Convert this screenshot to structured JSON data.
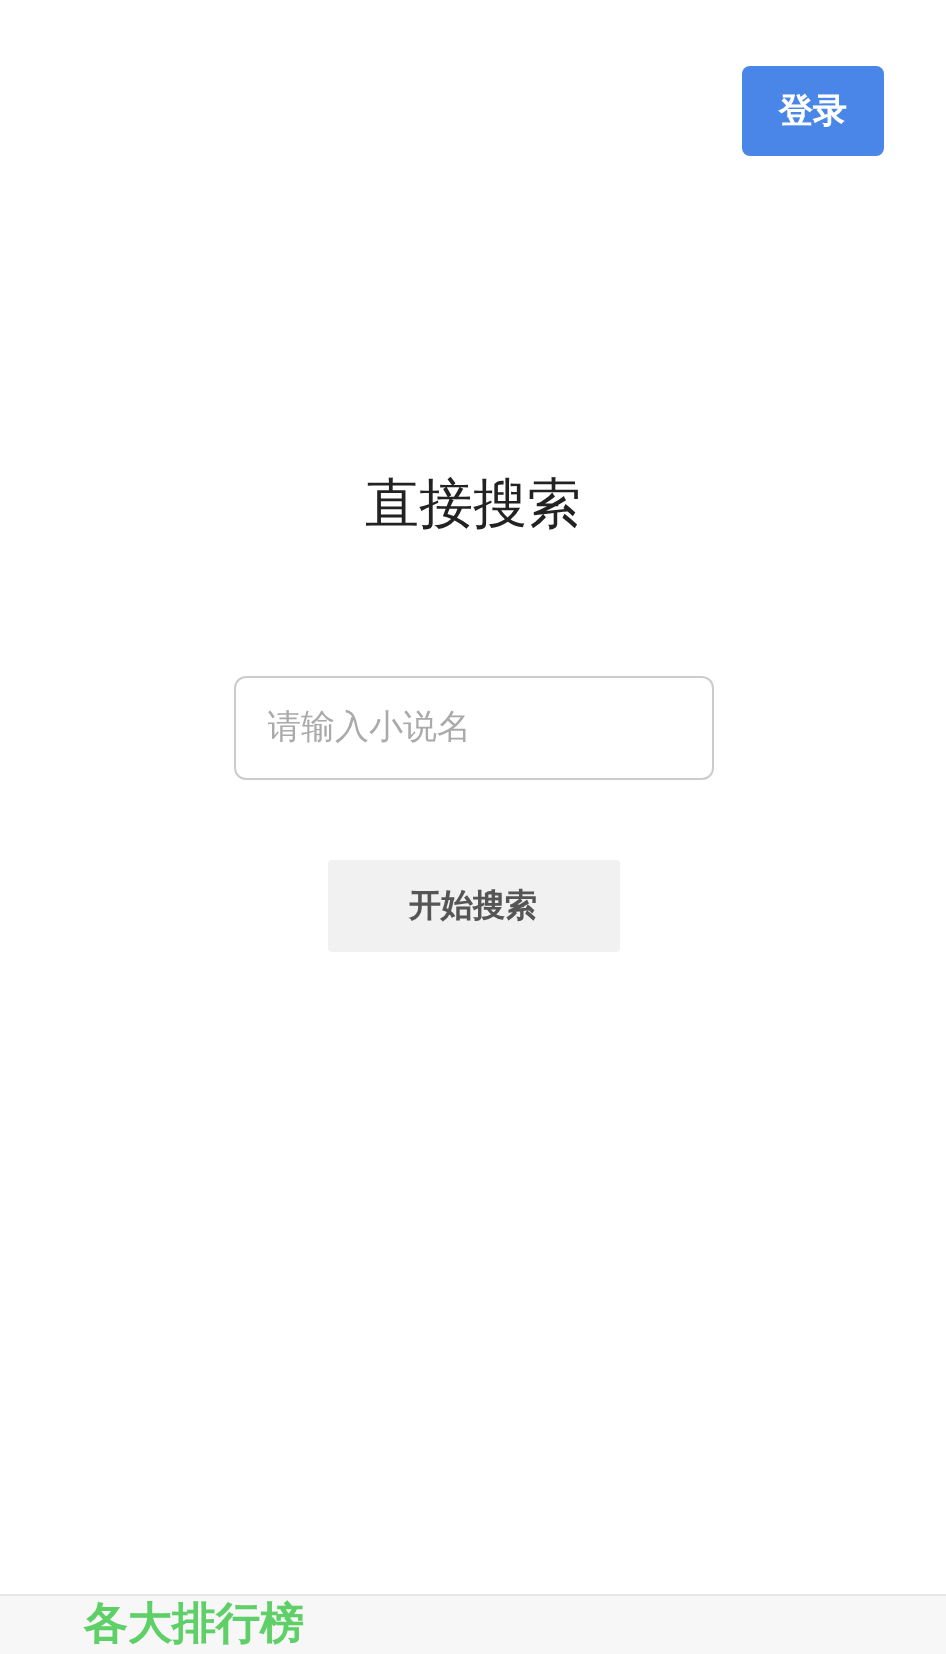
{
  "header": {
    "login_button": "登录"
  },
  "title": "直接搜索",
  "search": {
    "placeholder": "请输入小说名"
  },
  "search_button": "开始搜索",
  "bottom_bar": {
    "label": "各大排行榜"
  }
}
